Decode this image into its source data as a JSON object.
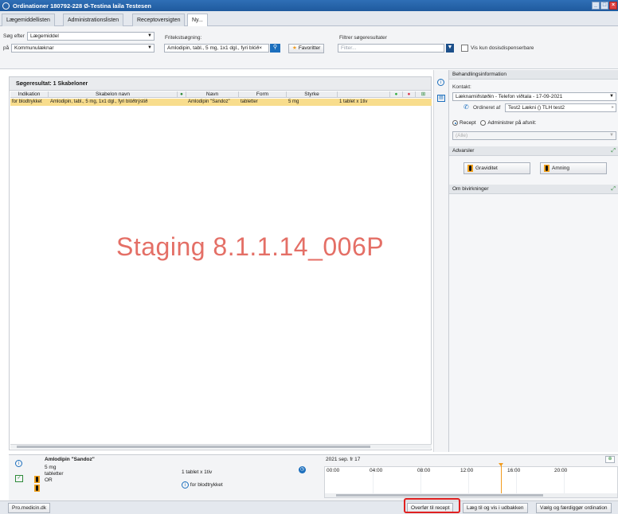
{
  "window": {
    "title": "Ordinationer 180792-228 Ø-Testina laila Testesen"
  },
  "tabs": [
    {
      "label": "Lægemiddellisten"
    },
    {
      "label": "Administrationslisten"
    },
    {
      "label": "Receptoversigten"
    },
    {
      "label": "Ny..."
    }
  ],
  "search": {
    "sog_efter_label": "Søg efter",
    "sog_efter_value": "Lægemiddel",
    "pa_label": "på",
    "pa_value": "Kommunulæknar",
    "fritekst_label": "Fritekstsøgning:",
    "fritekst_value": "Amlodipin, tabl., 5 mg, 1x1 dgl., fyri blóð×",
    "favorites_label": "Favoritter",
    "filter_label": "Filtrer søgeresultater",
    "filter_placeholder": "Filter...",
    "dosis_label": "Vis kun dosisdispenserbare"
  },
  "results": {
    "header": "Søgeresultat: 1 Skabeloner",
    "columns": [
      "Indikation",
      "Skabelon navn",
      "Navn",
      "Form",
      "Styrke"
    ],
    "rows": [
      {
        "indikation": "for blodtrykket",
        "skabelon": "Amlodipin, tabl., 5 mg, 1x1 dgl., fyri blóðtrýstið",
        "navn": "Amlodipin \"Sandoz\"",
        "form": "tabletter",
        "styrke": "5 mg",
        "dosis": "1 tablet x 1tiv"
      }
    ]
  },
  "watermark": "Staging 8.1.1.14_006P",
  "right_panel": {
    "behandling_header": "Behandlingsinformation",
    "kontakt_label": "Kontakt:",
    "kontakt_value": "Læknamiðstøðin - Telefon viðtala - 17-09-2021",
    "ordineret_label": "Ordineret af",
    "ordineret_value": "Test2 Lækni () TLH test2",
    "recept_label": "Recept",
    "administrer_label": "Administrer på afsnit:",
    "afsnit_placeholder": "(Alle)",
    "advarsler_header": "Advarsler",
    "graviditet_label": "Graviditet",
    "amning_label": "Amning",
    "bivirkninger_header": "Om bivirkninger"
  },
  "bottom": {
    "drug_name": "Amlodipin \"Sandoz\"",
    "strength": "5 mg",
    "form": "tabletter",
    "route": "OR",
    "dose": "1 tablet x 1tiv",
    "indication": "for blodtrykket",
    "timeline_date": "2021 sep. fr 17",
    "timeline_ticks": [
      "00:00",
      "04:00",
      "08:00",
      "12:00",
      "16:00",
      "20:00"
    ]
  },
  "statusbar": {
    "promedicin": "Pro.medicin.dk",
    "overfor": "Overfør til recept",
    "laeg_til": "Læg til og vis i udbakken",
    "vaelg": "Vælg og færdiggør ordination"
  }
}
